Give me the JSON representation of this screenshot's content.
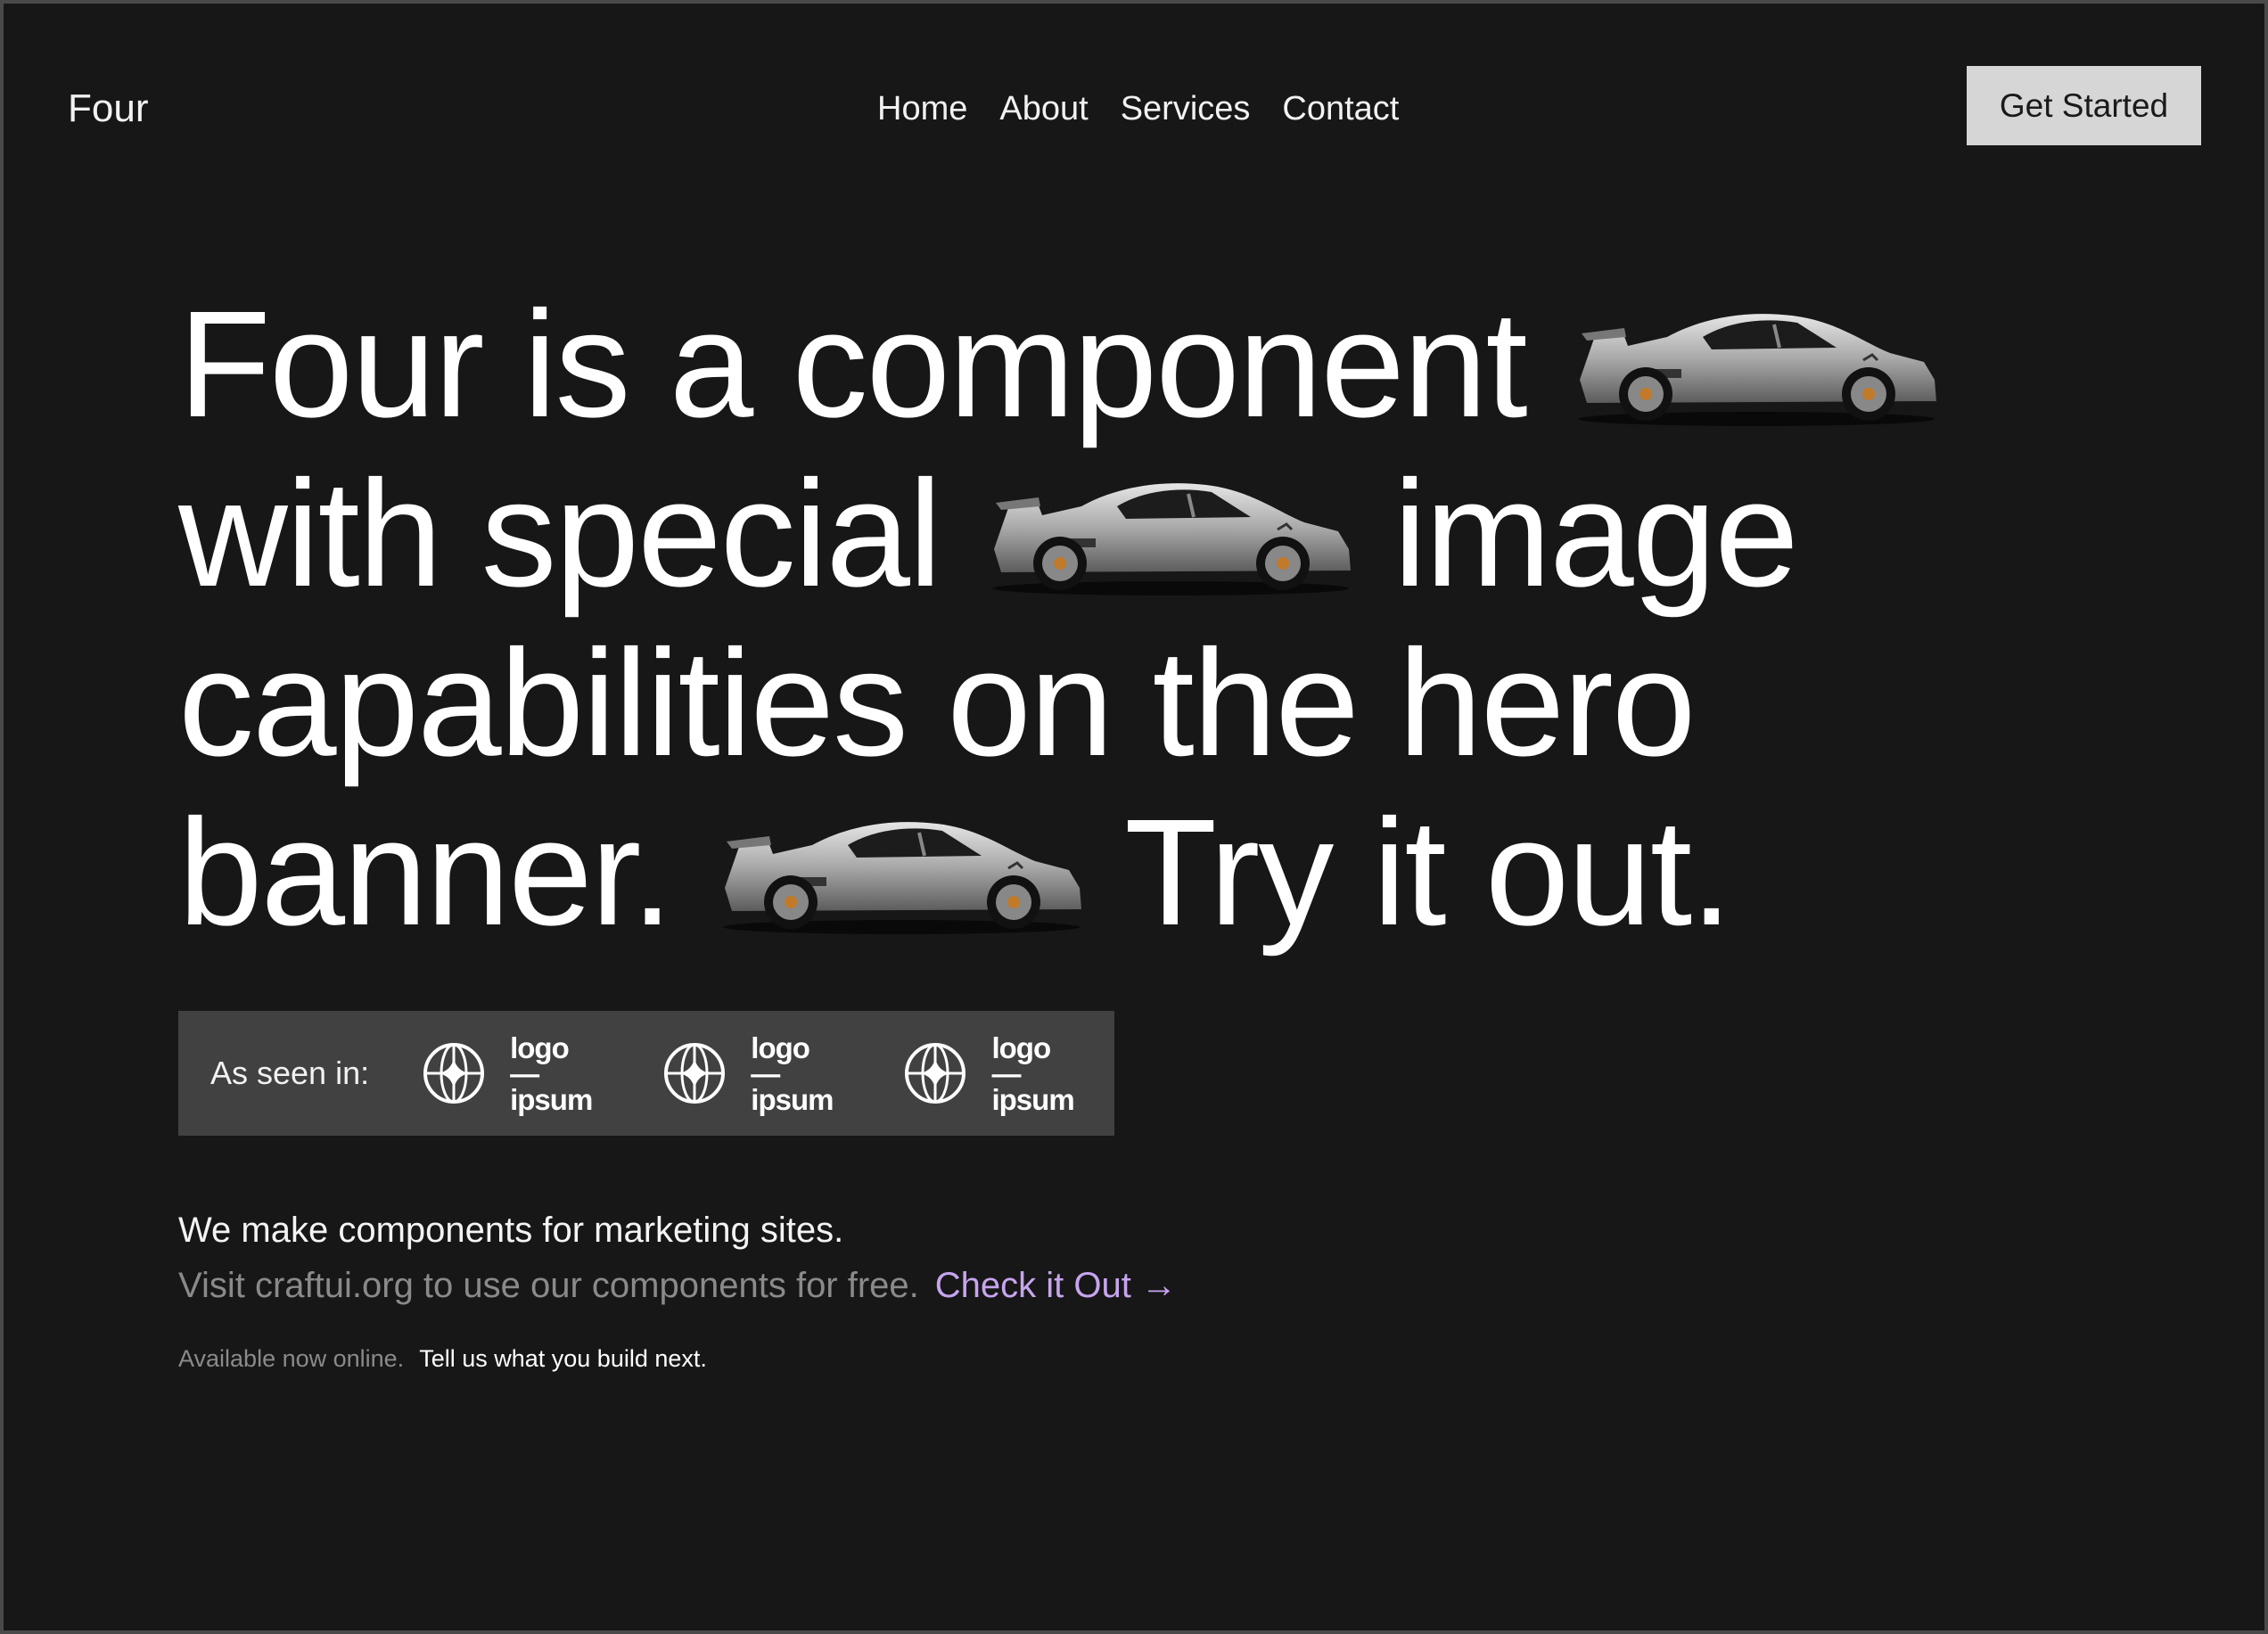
{
  "header": {
    "brand": "Four",
    "nav": [
      "Home",
      "About",
      "Services",
      "Contact"
    ],
    "cta": "Get Started"
  },
  "hero": {
    "line1_a": "Four is a component",
    "line2_a": "with special",
    "line2_b": "image",
    "line3": "capabilities on the hero",
    "line4_a": "banner.",
    "line4_b": "Try it out.",
    "image_icon": "sports-car-image"
  },
  "seen_in": {
    "label": "As seen in:",
    "logos": [
      {
        "top": "logo—",
        "bottom": "ipsum"
      },
      {
        "top": "logo—",
        "bottom": "ipsum"
      },
      {
        "top": "logo—",
        "bottom": "ipsum"
      }
    ]
  },
  "copy": {
    "tagline": "We make components for marketing sites.",
    "visit": "Visit craftui.org to use our components for free.",
    "link": "Check it Out →",
    "available": "Available now online.",
    "tell": "Tell us what you build next."
  },
  "colors": {
    "background": "#171717",
    "accent_link": "#c7a5ee",
    "cta_bg": "#d6d6d6",
    "seen_bg": "#414141"
  }
}
